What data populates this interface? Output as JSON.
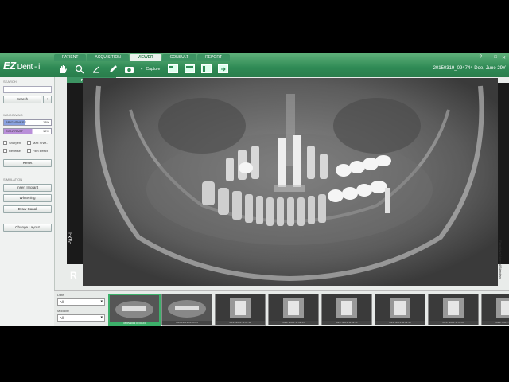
{
  "app": {
    "logo": "EZ",
    "logo_sub": "Dent - i",
    "tabs": [
      "PATIENT",
      "ACQUISITION",
      "VIEWER",
      "CONSULT",
      "REPORT"
    ],
    "active_tab": "VIEWER",
    "capture_label": "Capture",
    "patient_label": "20150319_094744  Doe, June 29Y",
    "window_controls": [
      "?",
      "–",
      "□",
      "✕"
    ]
  },
  "left": {
    "search_section": "SEARCH",
    "search_button": "Search",
    "plus_button": "+",
    "windowing_section": "WINDOWING",
    "brightness_label": "BRIGHTNESS",
    "brightness_value": "-13%",
    "contrast_label": "CONTRAST",
    "contrast_value": "19%",
    "checkboxes": [
      "Sharpen",
      "Max Shar..",
      "Reverse",
      "Film Effect"
    ],
    "reset_button": "Reset",
    "simulation_section": "SIMULATION",
    "insert_implant": "Insert Implant",
    "whitening": "Whitening",
    "draw_canal": "Draw Canal",
    "change_layout": "Change Layout"
  },
  "viewer": {
    "tab_label": "PANORAMA",
    "side_label": "PaX-i",
    "r_mark": "R",
    "right_label": "Repetitive/Normal/Standard"
  },
  "bottom": {
    "date_label": "Date",
    "date_value": "All",
    "modality_label": "Modality",
    "modality_value": "All",
    "thumbnails": [
      {
        "date": "06/25/2013 03:04:23",
        "active": true
      },
      {
        "date": "06/25/2013 03:04:23",
        "active": false
      },
      {
        "date": "06/27/2013 11:02:11",
        "active": false
      },
      {
        "date": "06/27/2013 11:02:15",
        "active": false
      },
      {
        "date": "06/27/2013 11:02:31",
        "active": false
      },
      {
        "date": "06/27/2013 11:02:43",
        "active": false
      },
      {
        "date": "06/27/2013 11:03:09",
        "active": false
      },
      {
        "date": "06/27/2013 11:03:27",
        "active": false
      }
    ]
  },
  "colors": {
    "brand": "#2f8a55",
    "accent": "#3cb06a",
    "brightness_bar": "#8aa2e0",
    "contrast_bar": "#b98fd9"
  }
}
